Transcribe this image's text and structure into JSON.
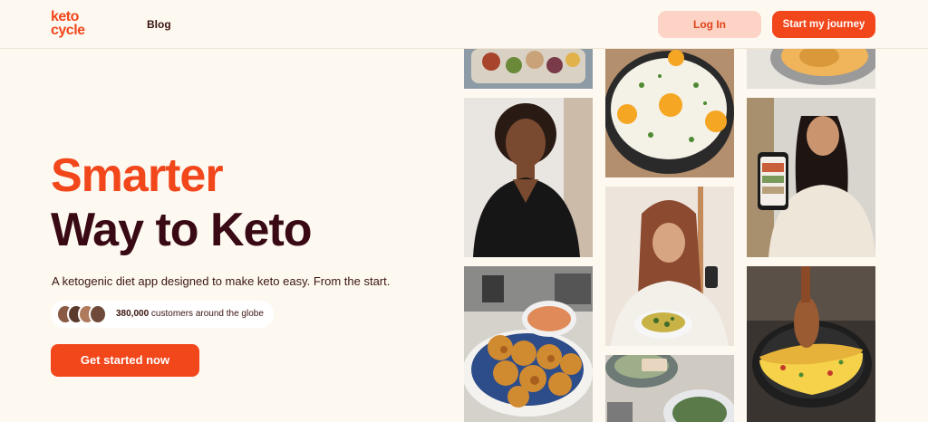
{
  "header": {
    "logo_line1": "keto",
    "logo_line2": "cycle",
    "nav_blog": "Blog",
    "login_label": "Log In",
    "start_label": "Start my journey"
  },
  "hero": {
    "title_accent": "Smarter",
    "title_main": "Way to Keto",
    "subtitle": "A ketogenic diet app designed to make keto easy. From the start.",
    "customers_count": "380,000",
    "customers_text": " customers around the globe",
    "cta_label": "Get started now"
  },
  "colors": {
    "brand": "#f2461b",
    "brand_light": "#fcd3c5",
    "heading_dark": "#3a0a14",
    "background": "#fdf9f1"
  },
  "gallery": [
    {
      "name": "food-salad-photo"
    },
    {
      "name": "fried-eggs-photo"
    },
    {
      "name": "pan-dish-photo"
    },
    {
      "name": "woman-smiling-photo"
    },
    {
      "name": "woman-with-phone-photo"
    },
    {
      "name": "woman-hijab-phone-photo"
    },
    {
      "name": "fritters-plate-photo"
    },
    {
      "name": "omelette-pan-photo"
    },
    {
      "name": "bowls-plates-photo"
    }
  ]
}
